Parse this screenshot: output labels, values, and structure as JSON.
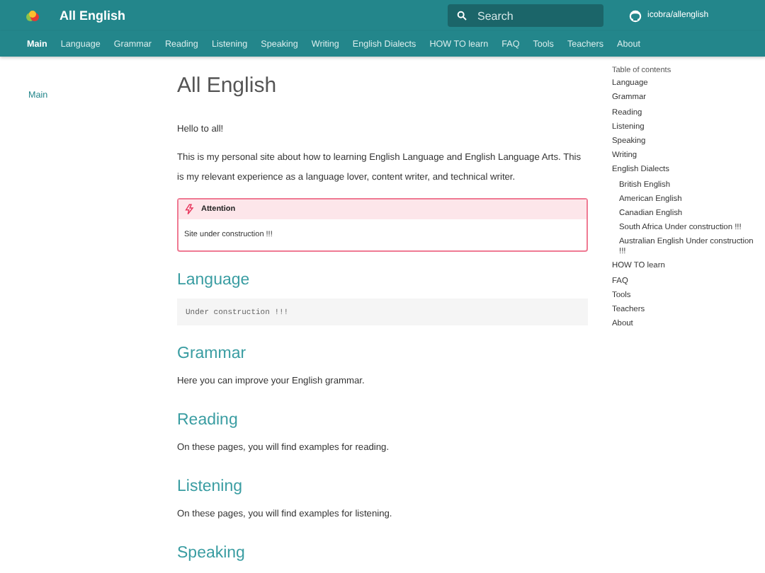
{
  "header": {
    "title": "All English",
    "search": {
      "placeholder": "Search"
    },
    "repo": "icobra/allenglish"
  },
  "tabs": [
    {
      "label": "Main",
      "selected": true
    },
    {
      "label": "Language",
      "selected": false
    },
    {
      "label": "Grammar",
      "selected": false
    },
    {
      "label": "Reading",
      "selected": false
    },
    {
      "label": "Listening",
      "selected": false
    },
    {
      "label": "Speaking",
      "selected": false
    },
    {
      "label": "Writing",
      "selected": false
    },
    {
      "label": "English Dialects",
      "selected": false
    },
    {
      "label": "HOW TO learn",
      "selected": false
    },
    {
      "label": "FAQ",
      "selected": false
    },
    {
      "label": "Tools",
      "selected": false
    },
    {
      "label": "Teachers",
      "selected": false
    },
    {
      "label": "About",
      "selected": false
    }
  ],
  "sidebar": {
    "items": [
      {
        "label": "Main",
        "selected": true
      }
    ]
  },
  "content": {
    "title": "All English",
    "blocks": [
      {
        "kind": "paragraph",
        "text": "Hello to all!"
      },
      {
        "kind": "paragraph",
        "text": "This is my personal site about how to learning English Language and English Language Arts. This is my relevant experience as a language lover, content writer, and technical writer."
      },
      {
        "kind": "admonition",
        "title": "Attention",
        "text": "Site under construction !!!"
      },
      {
        "kind": "heading",
        "text": "Language"
      },
      {
        "kind": "code",
        "text": "Under construction !!!"
      },
      {
        "kind": "heading",
        "text": "Grammar"
      },
      {
        "kind": "paragraph",
        "text": "Here you can improve your English grammar."
      },
      {
        "kind": "heading",
        "text": "Reading"
      },
      {
        "kind": "paragraph",
        "text": "On these pages, you will find examples for reading."
      },
      {
        "kind": "heading",
        "text": "Listening"
      },
      {
        "kind": "paragraph",
        "text": "On these pages, you will find examples for listening."
      },
      {
        "kind": "heading",
        "text": "Speaking"
      }
    ]
  },
  "toc": {
    "title": "Table of contents",
    "items": [
      {
        "label": "Language"
      },
      {
        "label": "Grammar"
      },
      {
        "label": "Reading"
      },
      {
        "label": "Listening"
      },
      {
        "label": "Speaking"
      },
      {
        "label": "Writing"
      },
      {
        "label": "English Dialects",
        "children": [
          {
            "label": "British English"
          },
          {
            "label": "American English"
          },
          {
            "label": "Canadian English"
          },
          {
            "label": "South Africa Under construction !!!"
          },
          {
            "label": "Australian English Under construction !!!"
          }
        ]
      },
      {
        "label": "HOW TO learn"
      },
      {
        "label": "FAQ"
      },
      {
        "label": "Tools"
      },
      {
        "label": "Teachers"
      },
      {
        "label": "About"
      }
    ]
  }
}
